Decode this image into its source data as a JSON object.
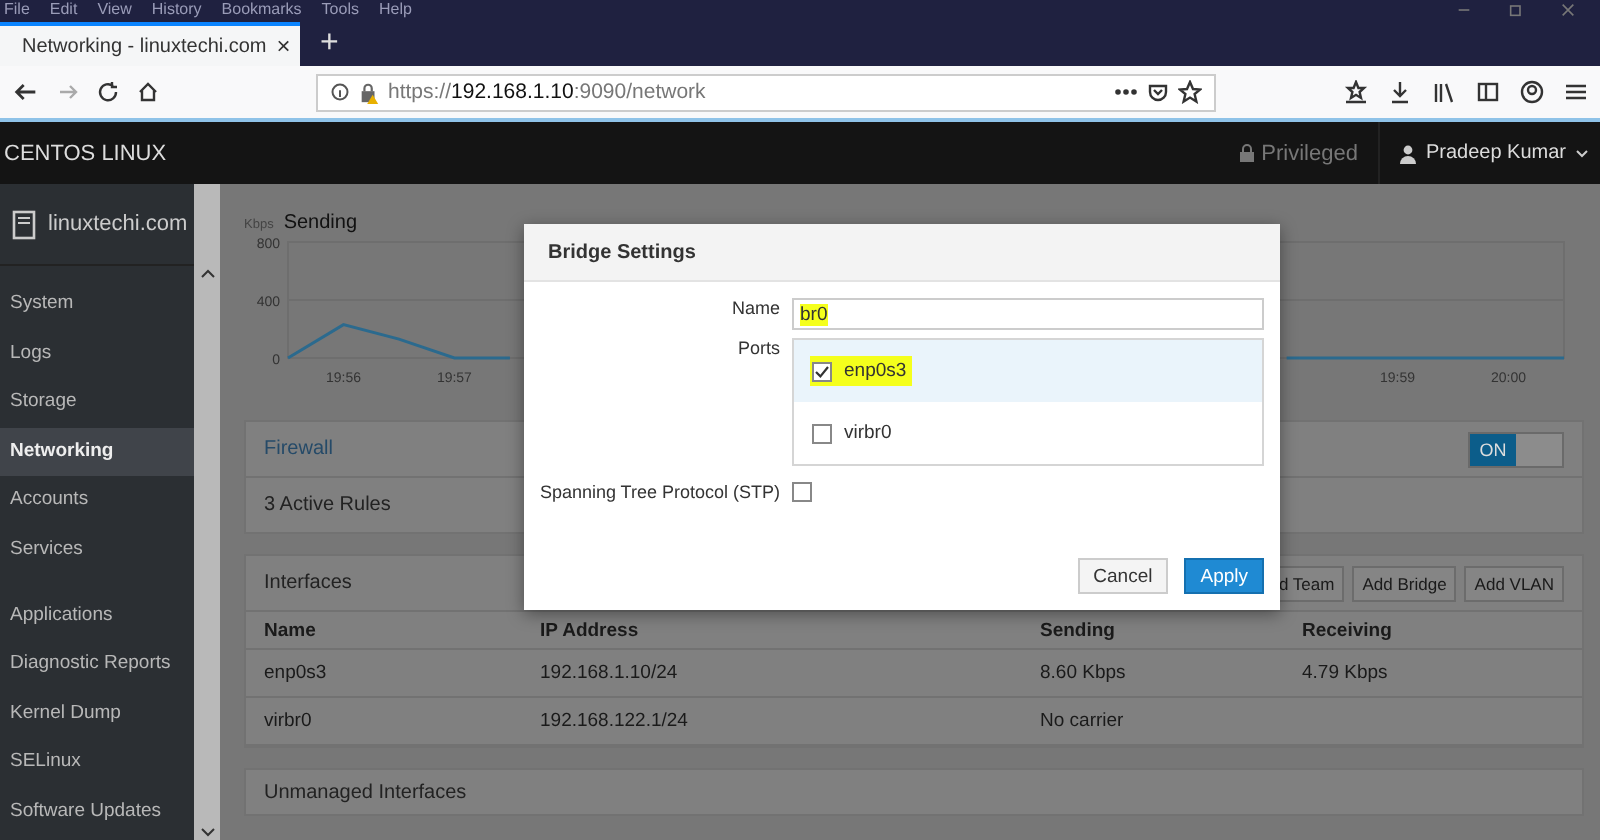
{
  "browser": {
    "menu": [
      "File",
      "Edit",
      "View",
      "History",
      "Bookmarks",
      "Tools",
      "Help"
    ],
    "tab": {
      "title": "Networking - linuxtechi.com",
      "close": "×"
    },
    "new_tab": "+",
    "url": "https://**192.168.1.10**:9090/network"
  },
  "header": {
    "brand": "CENTOS LINUX",
    "privileged": "Privileged",
    "user": "Pradeep Kumar"
  },
  "sidebar": {
    "host": "linuxtechi.com",
    "groups": [
      [
        {
          "label": "System",
          "selected": false
        },
        {
          "label": "Logs",
          "selected": false
        },
        {
          "label": "Storage",
          "selected": false
        },
        {
          "label": "Networking",
          "selected": true
        },
        {
          "label": "Accounts",
          "selected": false
        },
        {
          "label": "Services",
          "selected": false
        }
      ],
      [
        {
          "label": "Applications",
          "selected": false
        },
        {
          "label": "Diagnostic Reports",
          "selected": false
        },
        {
          "label": "Kernel Dump",
          "selected": false
        },
        {
          "label": "SELinux",
          "selected": false
        },
        {
          "label": "Software Updates",
          "selected": false
        }
      ]
    ]
  },
  "traffic": {
    "chart_data": {
      "type": "line",
      "title": "Sending",
      "ylabel": "Kbps",
      "ylim": [
        0,
        800
      ],
      "yticks": [
        0,
        400,
        800
      ],
      "categories": [
        null,
        "19:56",
        null,
        "19:57",
        null,
        null,
        null,
        null,
        null,
        null,
        null,
        null,
        null,
        null,
        null,
        null,
        null,
        null,
        null,
        null,
        "19:59",
        null,
        "20:00",
        null
      ],
      "series": [
        {
          "color": "#2b6a8e",
          "values": [
            0,
            230,
            130,
            0,
            0,
            null,
            null,
            null,
            null,
            null,
            null,
            null,
            null,
            null,
            null,
            null,
            null,
            null,
            0,
            0,
            0,
            0,
            0,
            0
          ]
        }
      ]
    }
  },
  "firewall": {
    "title": "Firewall",
    "on": true,
    "toggle_label": "ON",
    "rules": "3 Active Rules"
  },
  "interfaces": {
    "title": "Interfaces",
    "buttons": [
      "d Team",
      "Add Bridge",
      "Add VLAN"
    ],
    "columns": [
      "Name",
      "IP Address",
      "Sending",
      "Receiving"
    ],
    "rows": [
      [
        "enp0s3",
        "192.168.1.10/24",
        "8.60 Kbps",
        "4.79 Kbps"
      ],
      [
        "virbr0",
        "192.168.122.1/24",
        "No carrier"
      ]
    ]
  },
  "unmanaged": {
    "title": "Unmanaged Interfaces"
  },
  "dialog": {
    "title": "Bridge Settings",
    "name_label": "Name",
    "name_value": "br0",
    "name_highlighted": true,
    "ports_label": "Ports",
    "ports": [
      {
        "label": "enp0s3",
        "checked": true,
        "selected": true,
        "highlighted": true
      },
      {
        "label": "virbr0",
        "checked": false,
        "selected": false,
        "highlighted": false
      }
    ],
    "stp_label": "Spanning Tree Protocol (STP)",
    "stp_checked": false,
    "buttons": [
      {
        "label": "Cancel",
        "kind": "default"
      },
      {
        "label": "Apply",
        "kind": "primary"
      }
    ]
  }
}
